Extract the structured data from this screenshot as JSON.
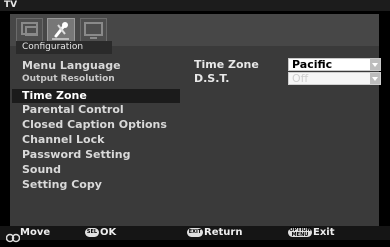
{
  "title": "TV",
  "tabs": [
    {
      "name": "picture-tab",
      "icon": "picture-icon",
      "active": false
    },
    {
      "name": "setup-tab",
      "icon": "wrench-screwdriver-icon",
      "active": true
    },
    {
      "name": "display-tab",
      "icon": "monitor-icon",
      "active": false
    }
  ],
  "section_header": "Configuration",
  "menu": [
    {
      "label": "Menu Language"
    },
    {
      "label": "Output Resolution"
    },
    {
      "label": "Time Zone"
    },
    {
      "label": "Parental Control"
    },
    {
      "label": "Closed Caption Options"
    },
    {
      "label": "Channel Lock"
    },
    {
      "label": "Password Setting"
    },
    {
      "label": "Sound"
    },
    {
      "label": "Setting Copy"
    }
  ],
  "selected_item": "Time Zone",
  "settings": {
    "time_zone_label": "Time Zone",
    "time_zone_value": "Pacific",
    "dst_label": "D.S.T.",
    "dst_value": "Off"
  },
  "footer": {
    "move_label": "Move",
    "ok_badge": "SEL",
    "ok_label": "OK",
    "exit_badge": "EXIT",
    "return_label": "Return",
    "option_badge": "OPTION MENU",
    "exit_label": "Exit"
  }
}
